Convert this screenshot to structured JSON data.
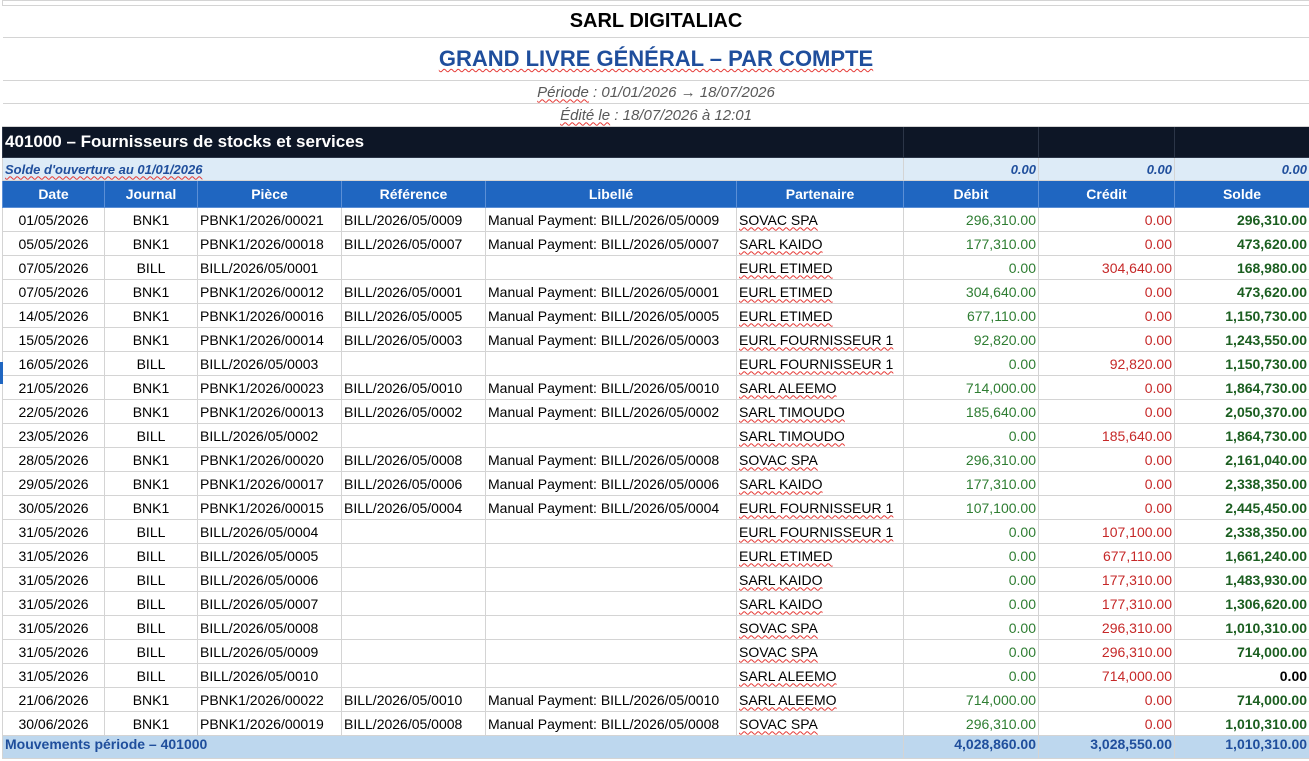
{
  "company": "SARL DIGITALIAC",
  "report_title": "GRAND LIVRE GÉNÉRAL – PAR COMPTE",
  "period": {
    "label": "Période",
    "text": " : 01/01/2026 → 18/07/2026"
  },
  "edited": {
    "label": "Édité le",
    "text": " : 18/07/2026 à 12:01"
  },
  "account": {
    "code": "401000",
    "separator": " – ",
    "name": "Fournisseurs de stocks et services"
  },
  "opening": {
    "label": "Solde d'ouverture au 01/01/2026",
    "debit": "0.00",
    "credit": "0.00",
    "solde": "0.00"
  },
  "columns": [
    "Date",
    "Journal",
    "Pièce",
    "Référence",
    "Libellé",
    "Partenaire",
    "Débit",
    "Crédit",
    "Solde"
  ],
  "rows": [
    {
      "date": "01/05/2026",
      "journal": "BNK1",
      "piece": "PBNK1/2026/00021",
      "ref": "BILL/2026/05/0009",
      "libelle": "Manual Payment: BILL/2026/05/0009",
      "partner": "SOVAC SPA",
      "debit": "296,310.00",
      "credit": "0.00",
      "solde": "296,310.00"
    },
    {
      "date": "05/05/2026",
      "journal": "BNK1",
      "piece": "PBNK1/2026/00018",
      "ref": "BILL/2026/05/0007",
      "libelle": "Manual Payment: BILL/2026/05/0007",
      "partner": "SARL KAIDO",
      "debit": "177,310.00",
      "credit": "0.00",
      "solde": "473,620.00"
    },
    {
      "date": "07/05/2026",
      "journal": "BILL",
      "piece": "BILL/2026/05/0001",
      "ref": "",
      "libelle": "",
      "partner": "EURL ETIMED",
      "debit": "0.00",
      "credit": "304,640.00",
      "solde": "168,980.00"
    },
    {
      "date": "07/05/2026",
      "journal": "BNK1",
      "piece": "PBNK1/2026/00012",
      "ref": "BILL/2026/05/0001",
      "libelle": "Manual Payment: BILL/2026/05/0001",
      "partner": "EURL ETIMED",
      "debit": "304,640.00",
      "credit": "0.00",
      "solde": "473,620.00"
    },
    {
      "date": "14/05/2026",
      "journal": "BNK1",
      "piece": "PBNK1/2026/00016",
      "ref": "BILL/2026/05/0005",
      "libelle": "Manual Payment: BILL/2026/05/0005",
      "partner": "EURL ETIMED",
      "debit": "677,110.00",
      "credit": "0.00",
      "solde": "1,150,730.00"
    },
    {
      "date": "15/05/2026",
      "journal": "BNK1",
      "piece": "PBNK1/2026/00014",
      "ref": "BILL/2026/05/0003",
      "libelle": "Manual Payment: BILL/2026/05/0003",
      "partner": "EURL FOURNISSEUR 1",
      "debit": "92,820.00",
      "credit": "0.00",
      "solde": "1,243,550.00"
    },
    {
      "date": "16/05/2026",
      "journal": "BILL",
      "piece": "BILL/2026/05/0003",
      "ref": "",
      "libelle": "",
      "partner": "EURL FOURNISSEUR 1",
      "debit": "0.00",
      "credit": "92,820.00",
      "solde": "1,150,730.00"
    },
    {
      "date": "21/05/2026",
      "journal": "BNK1",
      "piece": "PBNK1/2026/00023",
      "ref": "BILL/2026/05/0010",
      "libelle": "Manual Payment: BILL/2026/05/0010",
      "partner": "SARL ALEEMO",
      "debit": "714,000.00",
      "credit": "0.00",
      "solde": "1,864,730.00"
    },
    {
      "date": "22/05/2026",
      "journal": "BNK1",
      "piece": "PBNK1/2026/00013",
      "ref": "BILL/2026/05/0002",
      "libelle": "Manual Payment: BILL/2026/05/0002",
      "partner": "SARL TIMOUDO",
      "debit": "185,640.00",
      "credit": "0.00",
      "solde": "2,050,370.00"
    },
    {
      "date": "23/05/2026",
      "journal": "BILL",
      "piece": "BILL/2026/05/0002",
      "ref": "",
      "libelle": "",
      "partner": "SARL TIMOUDO",
      "debit": "0.00",
      "credit": "185,640.00",
      "solde": "1,864,730.00"
    },
    {
      "date": "28/05/2026",
      "journal": "BNK1",
      "piece": "PBNK1/2026/00020",
      "ref": "BILL/2026/05/0008",
      "libelle": "Manual Payment: BILL/2026/05/0008",
      "partner": "SOVAC SPA",
      "debit": "296,310.00",
      "credit": "0.00",
      "solde": "2,161,040.00"
    },
    {
      "date": "29/05/2026",
      "journal": "BNK1",
      "piece": "PBNK1/2026/00017",
      "ref": "BILL/2026/05/0006",
      "libelle": "Manual Payment: BILL/2026/05/0006",
      "partner": "SARL KAIDO",
      "debit": "177,310.00",
      "credit": "0.00",
      "solde": "2,338,350.00"
    },
    {
      "date": "30/05/2026",
      "journal": "BNK1",
      "piece": "PBNK1/2026/00015",
      "ref": "BILL/2026/05/0004",
      "libelle": "Manual Payment: BILL/2026/05/0004",
      "partner": "EURL FOURNISSEUR 1",
      "debit": "107,100.00",
      "credit": "0.00",
      "solde": "2,445,450.00"
    },
    {
      "date": "31/05/2026",
      "journal": "BILL",
      "piece": "BILL/2026/05/0004",
      "ref": "",
      "libelle": "",
      "partner": "EURL FOURNISSEUR 1",
      "debit": "0.00",
      "credit": "107,100.00",
      "solde": "2,338,350.00"
    },
    {
      "date": "31/05/2026",
      "journal": "BILL",
      "piece": "BILL/2026/05/0005",
      "ref": "",
      "libelle": "",
      "partner": "EURL ETIMED",
      "debit": "0.00",
      "credit": "677,110.00",
      "solde": "1,661,240.00"
    },
    {
      "date": "31/05/2026",
      "journal": "BILL",
      "piece": "BILL/2026/05/0006",
      "ref": "",
      "libelle": "",
      "partner": "SARL KAIDO",
      "debit": "0.00",
      "credit": "177,310.00",
      "solde": "1,483,930.00"
    },
    {
      "date": "31/05/2026",
      "journal": "BILL",
      "piece": "BILL/2026/05/0007",
      "ref": "",
      "libelle": "",
      "partner": "SARL KAIDO",
      "debit": "0.00",
      "credit": "177,310.00",
      "solde": "1,306,620.00"
    },
    {
      "date": "31/05/2026",
      "journal": "BILL",
      "piece": "BILL/2026/05/0008",
      "ref": "",
      "libelle": "",
      "partner": "SOVAC SPA",
      "debit": "0.00",
      "credit": "296,310.00",
      "solde": "1,010,310.00"
    },
    {
      "date": "31/05/2026",
      "journal": "BILL",
      "piece": "BILL/2026/05/0009",
      "ref": "",
      "libelle": "",
      "partner": "SOVAC SPA",
      "debit": "0.00",
      "credit": "296,310.00",
      "solde": "714,000.00"
    },
    {
      "date": "31/05/2026",
      "journal": "BILL",
      "piece": "BILL/2026/05/0010",
      "ref": "",
      "libelle": "",
      "partner": "SARL ALEEMO",
      "debit": "0.00",
      "credit": "714,000.00",
      "solde": "0.00"
    },
    {
      "date": "21/06/2026",
      "journal": "BNK1",
      "piece": "PBNK1/2026/00022",
      "ref": "BILL/2026/05/0010",
      "libelle": "Manual Payment: BILL/2026/05/0010",
      "partner": "SARL ALEEMO",
      "debit": "714,000.00",
      "credit": "0.00",
      "solde": "714,000.00"
    },
    {
      "date": "30/06/2026",
      "journal": "BNK1",
      "piece": "PBNK1/2026/00019",
      "ref": "BILL/2026/05/0008",
      "libelle": "Manual Payment: BILL/2026/05/0008",
      "partner": "SOVAC SPA",
      "debit": "296,310.00",
      "credit": "0.00",
      "solde": "1,010,310.00"
    }
  ],
  "total": {
    "label": "Mouvements période – 401000",
    "debit": "4,028,860.00",
    "credit": "3,028,550.00",
    "solde": "1,010,310.00"
  },
  "colors": {
    "header_blue": "#1f66c1",
    "account_bar": "#0d1626",
    "title_blue": "#1f4e9c",
    "debit_green": "#2e7d32",
    "credit_red": "#c62828",
    "solde_green": "#1b5e20"
  }
}
